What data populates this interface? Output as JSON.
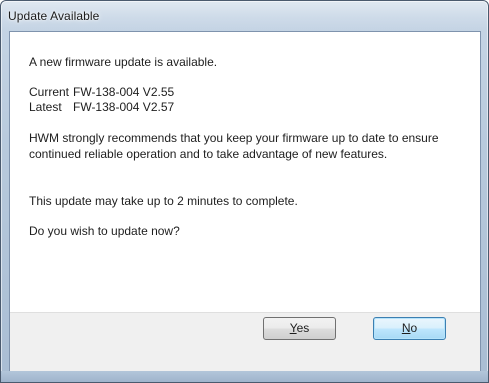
{
  "window": {
    "title": "Update Available"
  },
  "message": {
    "intro": "A new firmware update is available.",
    "current_label": "Current",
    "current_value": "FW-138-004 V2.55",
    "latest_label": "Latest",
    "latest_value": "FW-138-004 V2.57",
    "recommendation": "HWM strongly recommends that you keep your firmware up to date to ensure continued reliable operation and to take advantage of new features.",
    "duration": "This update may take up to 2 minutes to complete.",
    "question": "Do you wish to update now?"
  },
  "buttons": {
    "yes_accel": "Y",
    "yes_rest": "es",
    "no_accel": "N",
    "no_rest": "o"
  },
  "colors": {
    "frame": "#b7c9dc",
    "default_button_border": "#3c7fb1",
    "button_bar": "#f0f0f0"
  }
}
